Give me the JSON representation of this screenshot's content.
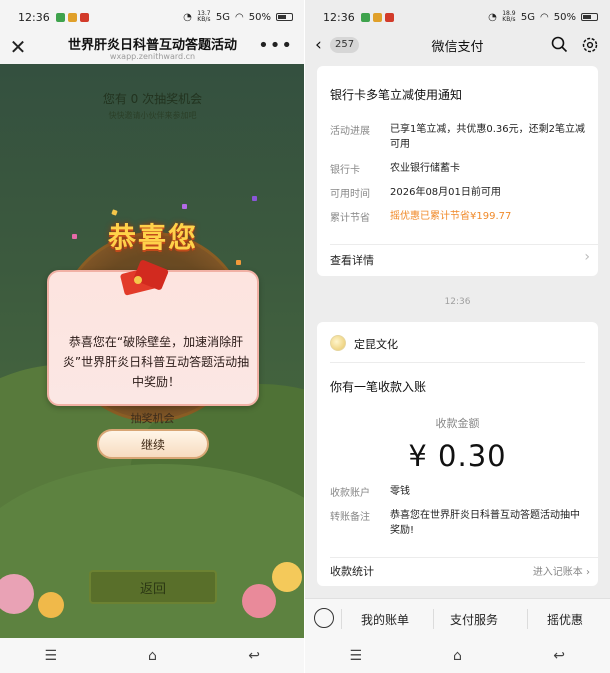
{
  "left": {
    "status": {
      "time": "12:36",
      "net_speed": "13.7 KB/s",
      "network": "5G",
      "battery": "50%"
    },
    "header": {
      "title": "世界肝炎日科普互动答题活动",
      "subtitle": "wxapp.zenithward.cn"
    },
    "game": {
      "chances": "您有 0 次抽奖机会",
      "hint": "快快邀请小伙伴来参加吧",
      "banner": "恭喜您",
      "message": "恭喜您在“破除壁垒，加速消除肝炎”世界肝炎日科普互动答题活动抽中奖励！",
      "below_card": "抽奖机会",
      "continue_label": "继续",
      "return_label": "返回"
    }
  },
  "right": {
    "status": {
      "time": "12:36",
      "net_speed": "18.9 KB/s",
      "network": "5G",
      "battery": "50%"
    },
    "header": {
      "badge": "257",
      "title": "微信支付"
    },
    "notice": {
      "title": "银行卡多笔立减使用通知",
      "rows": [
        {
          "label": "活动进展",
          "value": "已享1笔立减，共优惠0.36元，还剩2笔立减可用"
        },
        {
          "label": "银行卡",
          "value": "农业银行储蓄卡"
        },
        {
          "label": "可用时间",
          "value": "2026年08月01日前可用"
        },
        {
          "label": "累计节省",
          "value": "摇优惠已累计节省¥199.77"
        }
      ],
      "detail_label": "查看详情"
    },
    "timestamp": "12:36",
    "receipt": {
      "merchant": "定昆文化",
      "title": "你有一笔收款入账",
      "amount_label": "收款金额",
      "amount": "¥ 0.30",
      "rows": [
        {
          "label": "收款账户",
          "value": "零钱"
        },
        {
          "label": "转账备注",
          "value": "恭喜您在世界肝炎日科普互动答题活动抽中奖励!"
        }
      ],
      "stats_label": "收款统计",
      "stats_link": "进入记账本"
    },
    "menu": [
      "我的账单",
      "支付服务",
      "摇优惠"
    ]
  },
  "colors": {
    "accent_orange": "#f08a2a",
    "game_green": "#3c5a3e",
    "card_pink": "#fde4df"
  }
}
